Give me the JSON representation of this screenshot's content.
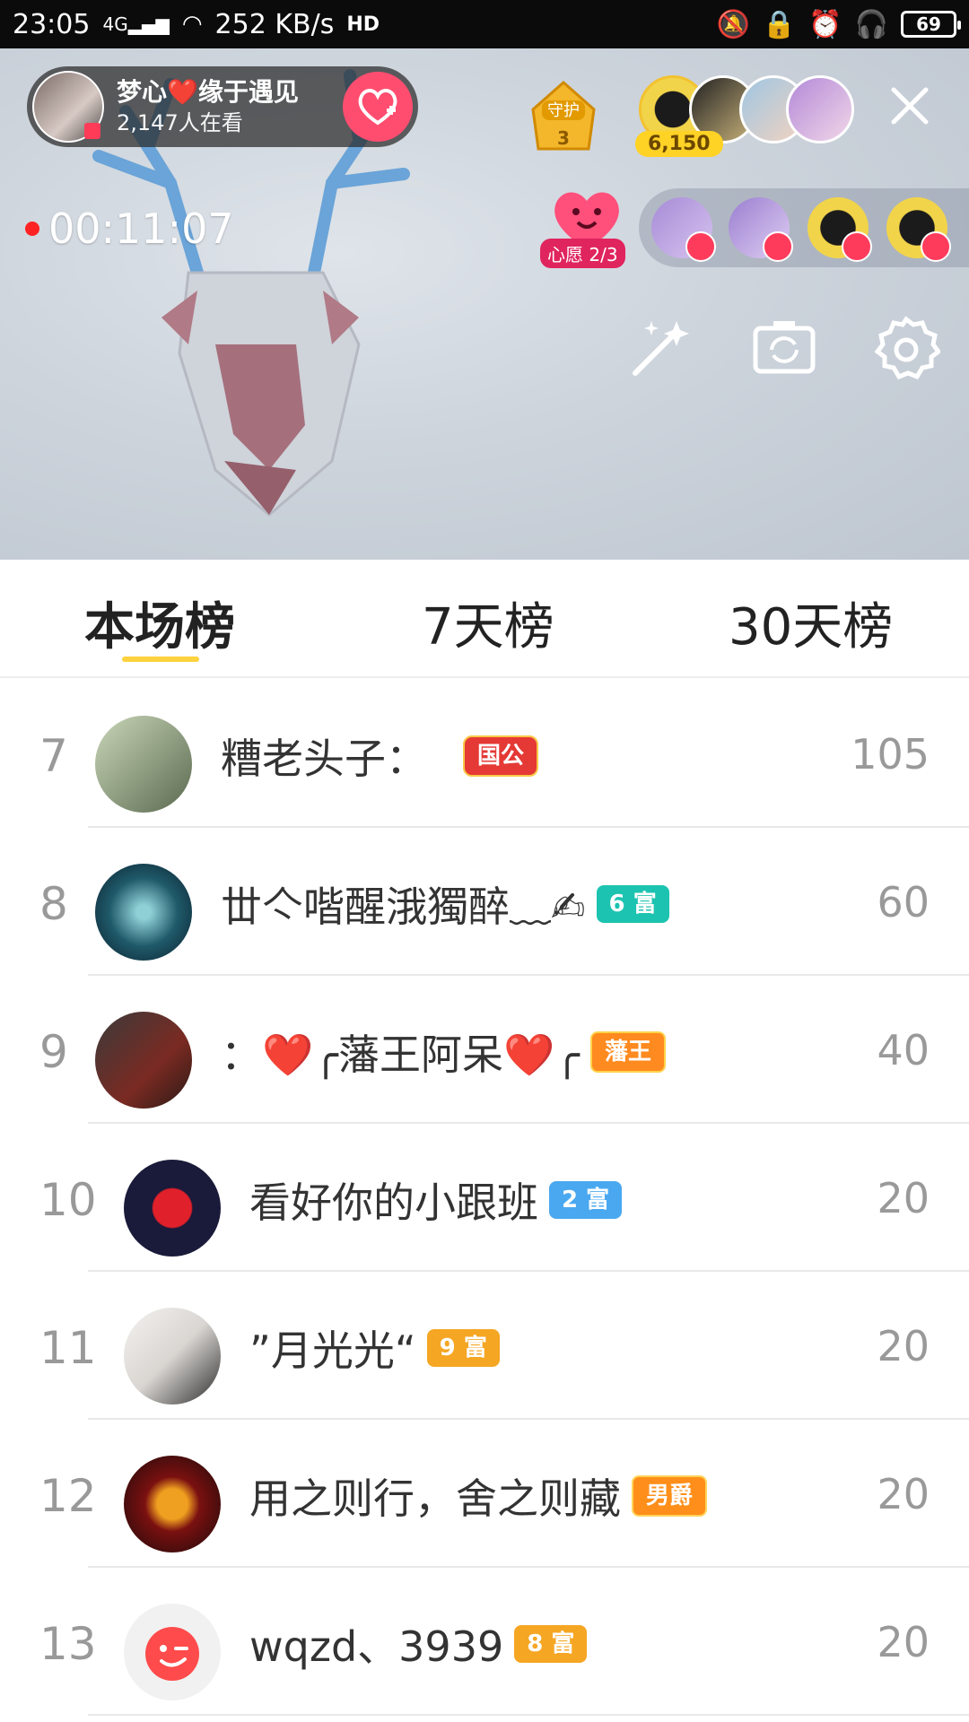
{
  "status_bar": {
    "time": "23:05",
    "network": "4G",
    "speed": "252 KB/s",
    "hd": "HD",
    "battery": "69"
  },
  "live": {
    "host_name": "梦心❤️缘于遇见",
    "viewers_text": "2,147人在看",
    "guard_label": "守护",
    "guard_count": "3",
    "coins": "6,150",
    "timer": "00:11:07",
    "wish_label": "心愿 2/3"
  },
  "tabs": {
    "current": "本场榜",
    "week": "7天榜",
    "month": "30天榜"
  },
  "ranking": [
    {
      "rank": "7",
      "name": "糟老头子：",
      "tag": "国公",
      "tag_style": "guogong",
      "score": "105",
      "avatar_color": "#6a7c5a"
    },
    {
      "rank": "8",
      "name": "丗亽喈醒涐獨醉﹏✍",
      "tag": "6 富",
      "tag_style": "fu6",
      "score": "60",
      "avatar_color": "#1f5a6a"
    },
    {
      "rank": "9",
      "name": "：❤️╭藩王阿呆❤️╭",
      "tag": "藩王",
      "tag_style": "fanwang",
      "score": "40",
      "avatar_color": "#5a2a22"
    },
    {
      "rank": "10",
      "name": "看好你的小跟班",
      "tag": "2 富",
      "tag_style": "fu2",
      "score": "20",
      "avatar_color": "#1a1a3a"
    },
    {
      "rank": "11",
      "name": "”月光光“",
      "tag": "9 富",
      "tag_style": "fu9",
      "score": "20",
      "avatar_color": "#d9d6d2"
    },
    {
      "rank": "12",
      "name": "用之则行，舍之则藏",
      "tag": "男爵",
      "tag_style": "nanjue",
      "score": "20",
      "avatar_color": "#7a1010"
    },
    {
      "rank": "13",
      "name": "wqzd、3939",
      "tag": "8 富",
      "tag_style": "fu8",
      "score": "20",
      "avatar_color": "#ff4b4b"
    }
  ],
  "colors": {
    "accent_underline": "#ffd23f",
    "live_red": "#ff2222",
    "follow_pink": "#ff4d70"
  }
}
